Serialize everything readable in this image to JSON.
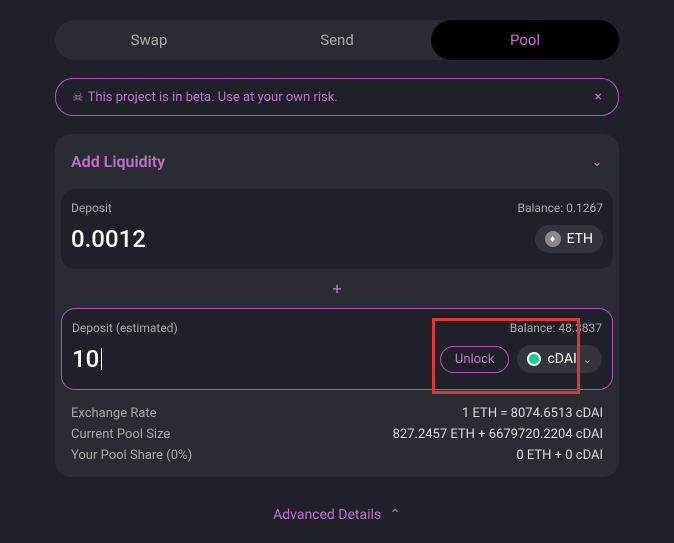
{
  "tabs": {
    "swap": "Swap",
    "send": "Send",
    "pool": "Pool"
  },
  "banner": {
    "text": "This project is in beta. Use at your own risk.",
    "close": "×"
  },
  "card": {
    "title": "Add Liquidity",
    "panel1": {
      "label": "Deposit",
      "balance": "Balance: 0.1267",
      "amount": "0.0012",
      "token": "ETH"
    },
    "plus": "+",
    "panel2": {
      "label": "Deposit (estimated)",
      "balance": "Balance: 48.3837",
      "amount": "10",
      "unlock": "Unlock",
      "token": "cDAI"
    },
    "stats": {
      "r1l": "Exchange Rate",
      "r1v": "1 ETH = 8074.6513 cDAI",
      "r2l": "Current Pool Size",
      "r2v": "827.2457 ETH + 6679720.2204 cDAI",
      "r3l": "Your Pool Share (0%)",
      "r3v": "0 ETH + 0 cDAI"
    }
  },
  "footer": "Advanced Details"
}
